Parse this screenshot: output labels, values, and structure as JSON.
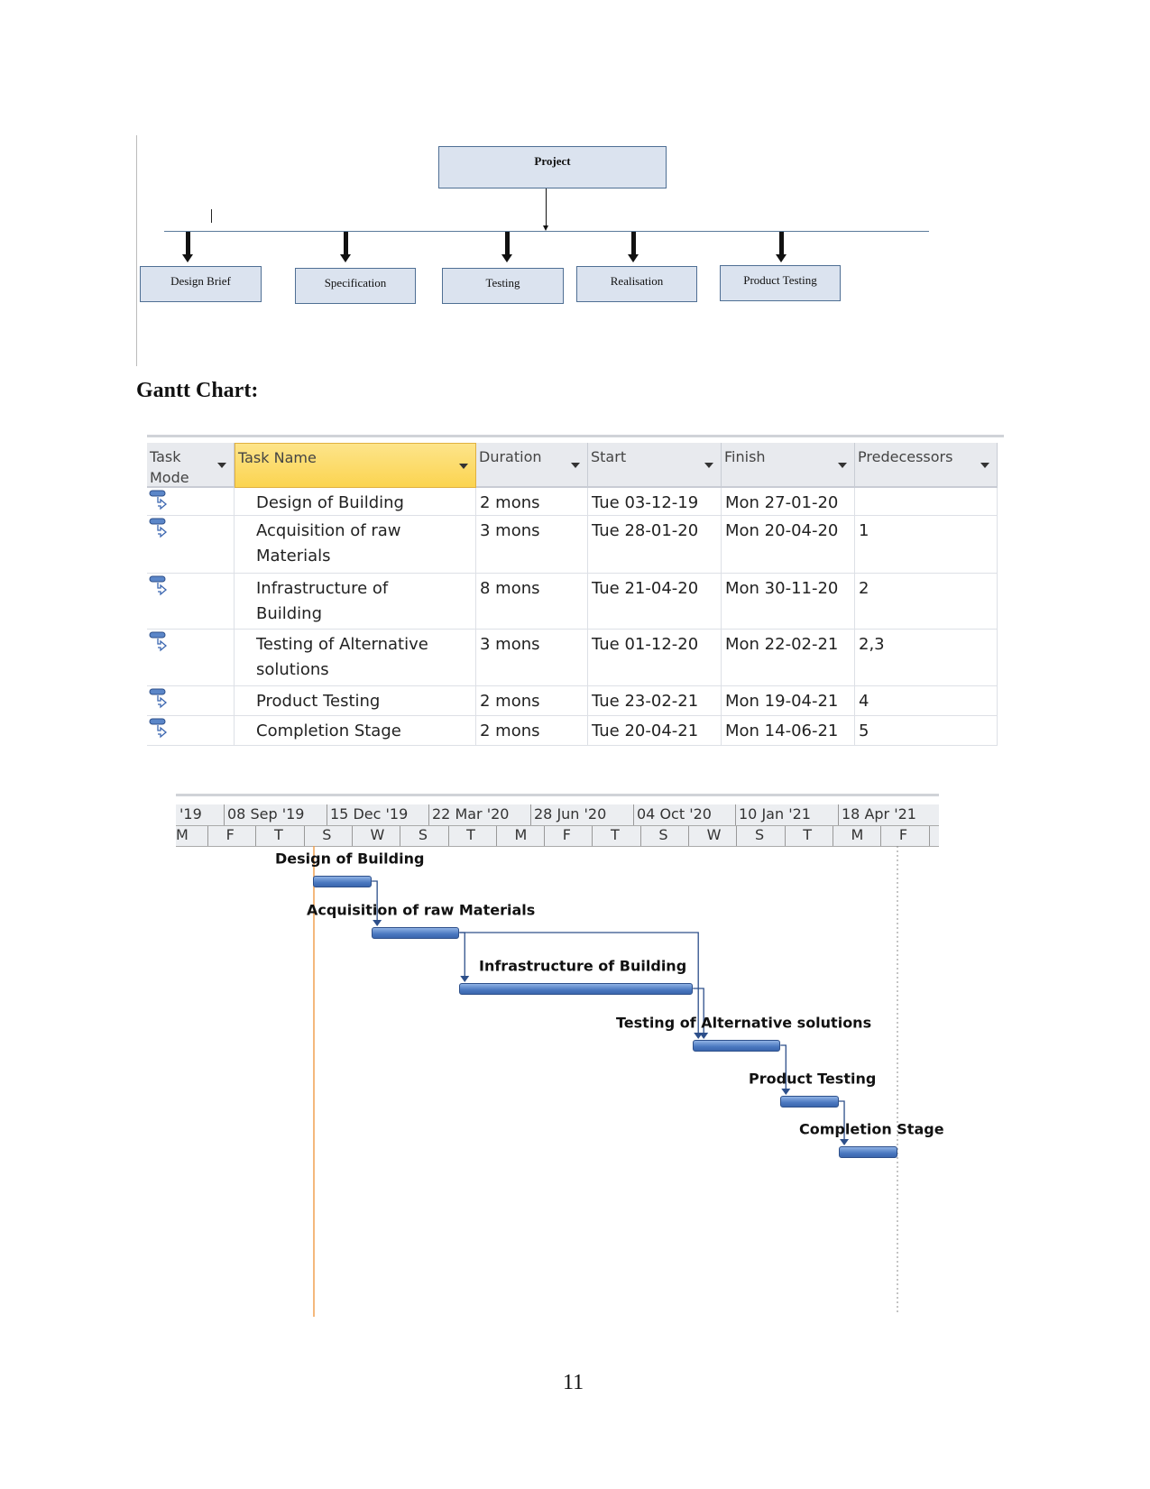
{
  "wbs": {
    "root": "Project",
    "children": [
      "Design Brief",
      "Specification",
      "Testing",
      "Realisation",
      "Product Testing"
    ]
  },
  "section_title": "Gantt Chart:",
  "table": {
    "columns": [
      "Task Mode",
      "Task Name",
      "Duration",
      "Start",
      "Finish",
      "Predecessors"
    ],
    "rows": [
      {
        "name": "Design of Building",
        "duration": "2 mons",
        "start": "Tue 03-12-19",
        "finish": "Mon 27-01-20",
        "pred": ""
      },
      {
        "name": "Acquisition of raw Materials",
        "duration": "3 mons",
        "start": "Tue 28-01-20",
        "finish": "Mon 20-04-20",
        "pred": "1"
      },
      {
        "name": "Infrastructure of Building",
        "duration": "8 mons",
        "start": "Tue 21-04-20",
        "finish": "Mon 30-11-20",
        "pred": "2"
      },
      {
        "name": "Testing of Alternative solutions",
        "duration": "3 mons",
        "start": "Tue 01-12-20",
        "finish": "Mon 22-02-21",
        "pred": "2,3"
      },
      {
        "name": "Product Testing",
        "duration": "2 mons",
        "start": "Tue 23-02-21",
        "finish": "Mon 19-04-21",
        "pred": "4"
      },
      {
        "name": "Completion Stage",
        "duration": "2 mons",
        "start": "Tue 20-04-21",
        "finish": "Mon 14-06-21",
        "pred": "5"
      }
    ]
  },
  "chart_data": {
    "type": "gantt",
    "major_ticks": [
      "'19",
      "08 Sep '19",
      "15 Dec '19",
      "22 Mar '20",
      "28 Jun '20",
      "04 Oct '20",
      "10 Jan '21",
      "18 Apr '21"
    ],
    "minor_ticks": [
      "M",
      "F",
      "T",
      "S",
      "W",
      "S",
      "T",
      "M",
      "F",
      "T",
      "S",
      "W",
      "S",
      "T",
      "M",
      "F"
    ],
    "tasks": [
      {
        "name": "Design of Building",
        "start": "2019-12-03",
        "finish": "2020-01-27",
        "pred": []
      },
      {
        "name": "Acquisition of raw Materials",
        "start": "2020-01-28",
        "finish": "2020-04-20",
        "pred": [
          1
        ]
      },
      {
        "name": "Infrastructure of Building",
        "start": "2020-04-21",
        "finish": "2020-11-30",
        "pred": [
          2
        ]
      },
      {
        "name": "Testing of Alternative solutions",
        "start": "2020-12-01",
        "finish": "2021-02-22",
        "pred": [
          2,
          3
        ]
      },
      {
        "name": "Product Testing",
        "start": "2021-02-23",
        "finish": "2021-04-19",
        "pred": [
          4
        ]
      },
      {
        "name": "Completion Stage",
        "start": "2021-04-20",
        "finish": "2021-06-14",
        "pred": [
          5
        ]
      }
    ],
    "bar_color": "#4a78c0",
    "today_line_color": "#f0a050"
  },
  "page_number": "11"
}
